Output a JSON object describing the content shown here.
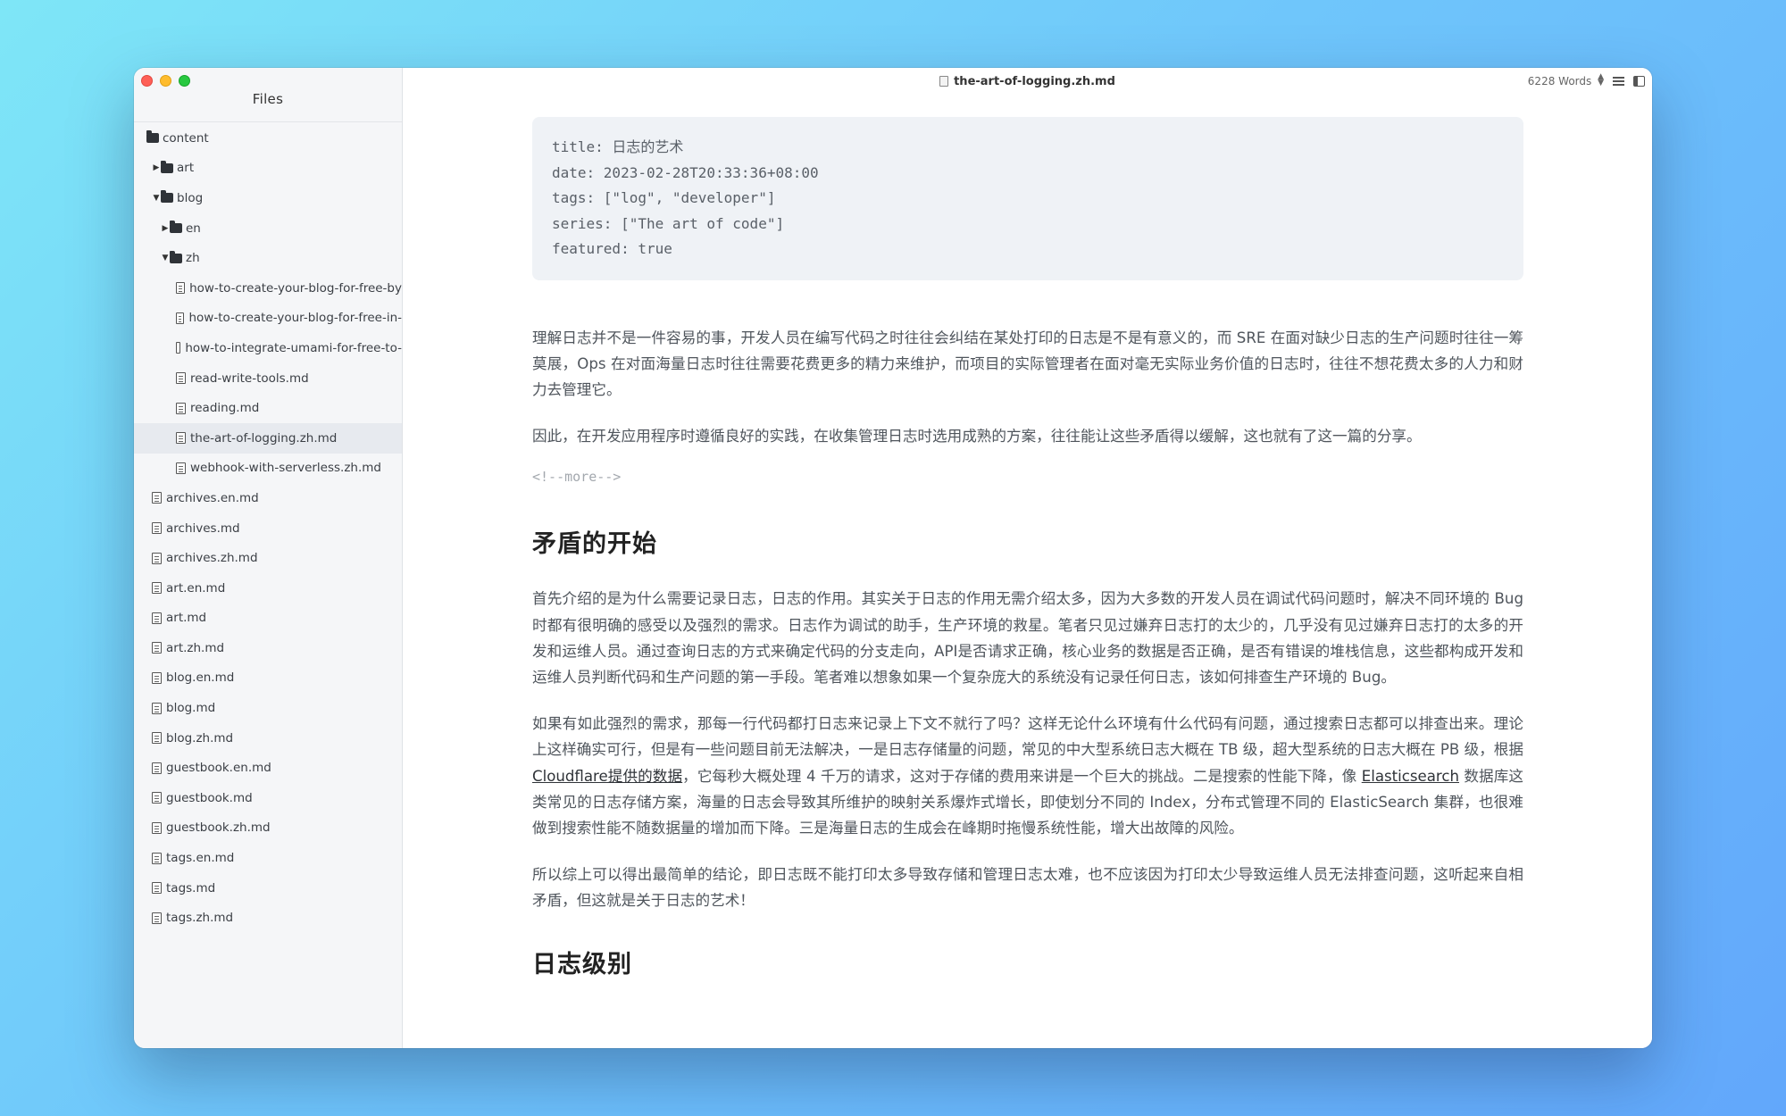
{
  "window": {
    "filename": "the-art-of-logging.zh.md",
    "word_count": "6228 Words"
  },
  "sidebar": {
    "title": "Files",
    "tree": [
      {
        "label": "content",
        "type": "folder",
        "depth": 0,
        "arrow": ""
      },
      {
        "label": "art",
        "type": "folder",
        "depth": 1,
        "arrow": "▶"
      },
      {
        "label": "blog",
        "type": "folder",
        "depth": 1,
        "arrow": "▼"
      },
      {
        "label": "en",
        "type": "folder",
        "depth": 2,
        "arrow": "▶"
      },
      {
        "label": "zh",
        "type": "folder",
        "depth": 2,
        "arrow": "▼"
      },
      {
        "label": "how-to-create-your-blog-for-free-by",
        "type": "file",
        "depth": 3
      },
      {
        "label": "how-to-create-your-blog-for-free-in-",
        "type": "file",
        "depth": 3
      },
      {
        "label": "how-to-integrate-umami-for-free-to-",
        "type": "file",
        "depth": 3
      },
      {
        "label": "read-write-tools.md",
        "type": "file",
        "depth": 3
      },
      {
        "label": "reading.md",
        "type": "file",
        "depth": 3
      },
      {
        "label": "the-art-of-logging.zh.md",
        "type": "file",
        "depth": 3,
        "selected": true
      },
      {
        "label": "webhook-with-serverless.zh.md",
        "type": "file",
        "depth": 3
      },
      {
        "label": "archives.en.md",
        "type": "file",
        "depth": 1
      },
      {
        "label": "archives.md",
        "type": "file",
        "depth": 1
      },
      {
        "label": "archives.zh.md",
        "type": "file",
        "depth": 1
      },
      {
        "label": "art.en.md",
        "type": "file",
        "depth": 1
      },
      {
        "label": "art.md",
        "type": "file",
        "depth": 1
      },
      {
        "label": "art.zh.md",
        "type": "file",
        "depth": 1
      },
      {
        "label": "blog.en.md",
        "type": "file",
        "depth": 1
      },
      {
        "label": "blog.md",
        "type": "file",
        "depth": 1
      },
      {
        "label": "blog.zh.md",
        "type": "file",
        "depth": 1
      },
      {
        "label": "guestbook.en.md",
        "type": "file",
        "depth": 1
      },
      {
        "label": "guestbook.md",
        "type": "file",
        "depth": 1
      },
      {
        "label": "guestbook.zh.md",
        "type": "file",
        "depth": 1
      },
      {
        "label": "tags.en.md",
        "type": "file",
        "depth": 1
      },
      {
        "label": "tags.md",
        "type": "file",
        "depth": 1
      },
      {
        "label": "tags.zh.md",
        "type": "file",
        "depth": 1
      }
    ]
  },
  "document": {
    "frontmatter": [
      "title: 日志的艺术",
      "date: 2023-02-28T20:33:36+08:00",
      "tags: [\"log\", \"developer\"]",
      "series: [\"The art of code\"]",
      "featured: true"
    ],
    "para1": "理解日志并不是一件容易的事，开发人员在编写代码之时往往会纠结在某处打印的日志是不是有意义的，而 SRE 在面对缺少日志的生产问题时往往一筹莫展，Ops 在对面海量日志时往往需要花费更多的精力来维护，而项目的实际管理者在面对毫无实际业务价值的日志时，往往不想花费太多的人力和财力去管理它。",
    "para2": "因此，在开发应用程序时遵循良好的实践，在收集管理日志时选用成熟的方案，往往能让这些矛盾得以缓解，这也就有了这一篇的分享。",
    "more_comment": "<!--more-->",
    "heading1": "矛盾的开始",
    "para3": "首先介绍的是为什么需要记录日志，日志的作用。其实关于日志的作用无需介绍太多，因为大多数的开发人员在调试代码问题时，解决不同环境的 Bug 时都有很明确的感受以及强烈的需求。日志作为调试的助手，生产环境的救星。笔者只见过嫌弃日志打的太少的，几乎没有见过嫌弃日志打的太多的开发和运维人员。通过查询日志的方式来确定代码的分支走向，API是否请求正确，核心业务的数据是否正确，是否有错误的堆栈信息，这些都构成开发和运维人员判断代码和生产问题的第一手段。笔者难以想象如果一个复杂庞大的系统没有记录任何日志，该如何排查生产环境的 Bug。",
    "para4_a": "如果有如此强烈的需求，那每一行代码都打日志来记录上下文不就行了吗？这样无论什么环境有什么代码有问题，通过搜索日志都可以排查出来。理论上这样确实可行，但是有一些问题目前无法解决，一是日志存储量的问题，常见的中大型系统日志大概在 TB 级，超大型系统的日志大概在 PB 级，根据 ",
    "para4_link1": "Cloudflare提供的数据",
    "para4_b": "，它每秒大概处理 4 千万的请求，这对于存储的费用来讲是一个巨大的挑战。二是搜索的性能下降，像 ",
    "para4_link2": "Elasticsearch",
    "para4_c": " 数据库这类常见的日志存储方案，海量的日志会导致其所维护的映射关系爆炸式增长，即使划分不同的 Index，分布式管理不同的 ElasticSearch 集群，也很难做到搜索性能不随数据量的增加而下降。三是海量日志的生成会在峰期时拖慢系统性能，增大出故障的风险。",
    "para5": "所以综上可以得出最简单的结论，即日志既不能打印太多导致存储和管理日志太难，也不应该因为打印太少导致运维人员无法排查问题，这听起来自相矛盾，但这就是关于日志的艺术！",
    "heading2": "日志级别"
  }
}
